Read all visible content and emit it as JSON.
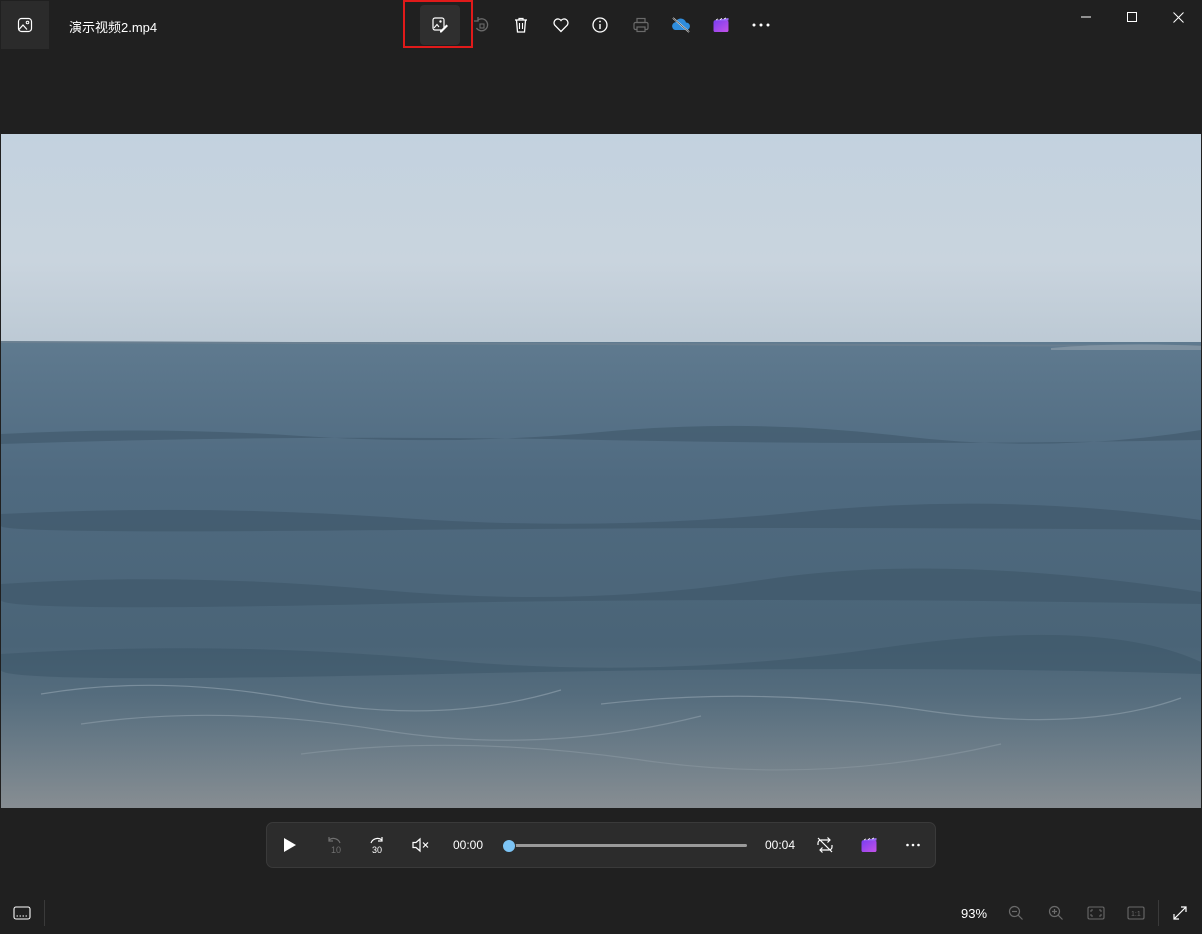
{
  "window": {
    "file_name": "演示视频2.mp4"
  },
  "toolbar": {
    "items": [
      {
        "icon": "edit-image-icon",
        "active": true
      },
      {
        "icon": "rotate-icon",
        "disabled": true
      },
      {
        "icon": "delete-icon"
      },
      {
        "icon": "favorite-heart-icon"
      },
      {
        "icon": "info-icon"
      },
      {
        "icon": "print-icon",
        "disabled": true
      },
      {
        "icon": "onedrive-cloud-icon"
      },
      {
        "icon": "clipchamp-icon"
      },
      {
        "icon": "more-icon"
      }
    ],
    "highlight_color": "#e01a1a"
  },
  "player": {
    "current_time": "00:00",
    "total_time": "00:04",
    "progress": 0.0,
    "accent": "#7cc4f5",
    "skip_back_label": "10",
    "skip_forward_label": "30"
  },
  "statusbar": {
    "zoom": "93%",
    "actual_size_label": "1:1"
  },
  "colors": {
    "background": "#202020",
    "panel": "#2c2c2c"
  }
}
